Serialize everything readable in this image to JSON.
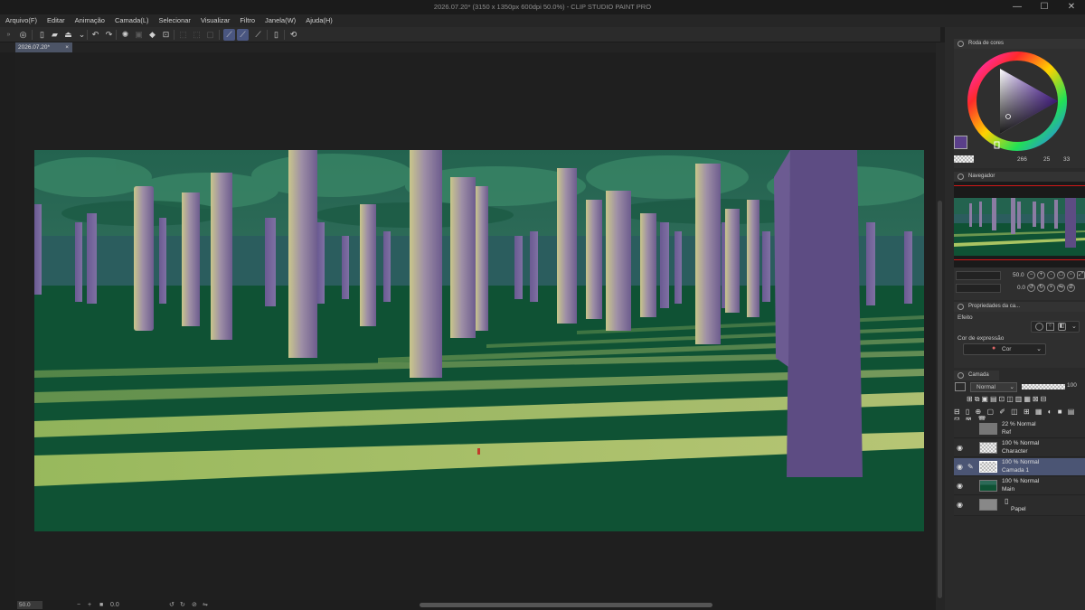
{
  "window": {
    "title": "2026.07.20* (3150 x 1350px 600dpi 50.0%) - CLIP STUDIO PAINT PRO",
    "controls": [
      "—",
      "☐",
      "✕"
    ]
  },
  "menu": [
    "Arquivo(F)",
    "Editar",
    "Animação",
    "Camada(L)",
    "Selecionar",
    "Visualizar",
    "Filtro",
    "Janela(W)",
    "Ajuda(H)"
  ],
  "toolbar": {
    "icons": [
      "clip-studio-icon",
      "new-file-icon",
      "open-file-icon",
      "save-icon",
      "upload-icon",
      "undo-icon",
      "redo-icon",
      "clear-icon",
      "fill-icon",
      "transform-icon",
      "crop-icon",
      "deselect-icon",
      "invert-selection-icon",
      "select-icon",
      "ruler-snap-icon",
      "special-ruler-icon",
      "grid-snap-icon",
      "smartphone-icon",
      "refresh-icon"
    ]
  },
  "document_tab": {
    "label": "2026.07.20*",
    "close": "×"
  },
  "status": {
    "zoom": "50.0",
    "minus": "−",
    "plus": "+",
    "angle": "0.0"
  },
  "color_wheel": {
    "tab_label": "Roda de cores",
    "values": [
      "266",
      "25",
      "33"
    ],
    "main_color": "#5a3f8a"
  },
  "navigator": {
    "tab_label": "Navegador",
    "zoom": "50.0",
    "rotation": "0.0"
  },
  "properties": {
    "tab_label": "Propriedades da ca...",
    "effect_label": "Efeito",
    "expression_label": "Cor de expressão",
    "expression_value": "Cor"
  },
  "layers": {
    "tab_label": "Camada",
    "blend_mode": "Normal",
    "opacity": "100",
    "items": [
      {
        "opacity": "22 % Normal",
        "name": "Ref",
        "visible": false,
        "selected": false
      },
      {
        "opacity": "100 % Normal",
        "name": "Character",
        "visible": true,
        "selected": false
      },
      {
        "opacity": "100 % Normal",
        "name": "Camada 1",
        "visible": true,
        "selected": true
      },
      {
        "opacity": "100 % Normal",
        "name": "Main",
        "visible": true,
        "selected": false
      },
      {
        "opacity": "",
        "name": "Papel",
        "visible": true,
        "selected": false
      }
    ]
  },
  "artwork": {
    "sky": "#2a6a55",
    "fog": "#2b5e5f",
    "ground": "#0f5234",
    "light_band": "#a9c462",
    "trunk": "#7b6a9a",
    "trunk_light": "#c6c486"
  }
}
